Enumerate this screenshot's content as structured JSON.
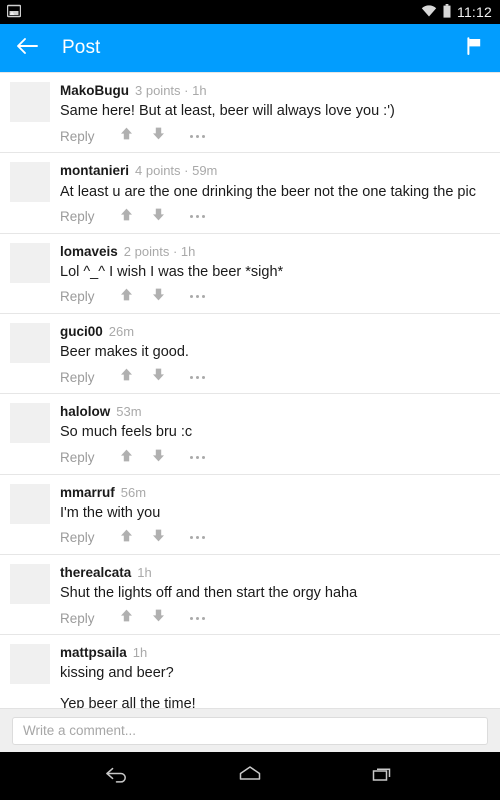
{
  "status_bar": {
    "notification_icon": "image-notification-icon",
    "wifi_icon": "wifi-icon",
    "battery_icon": "battery-icon",
    "clock": "11:12"
  },
  "app_bar": {
    "back_icon": "back-arrow-icon",
    "title": "Post",
    "flag_icon": "flag-icon",
    "background_color": "#029dfe",
    "foreground_color": "#ffffff"
  },
  "actions": {
    "reply_label": "Reply",
    "upvote_icon": "upvote-arrow-icon",
    "downvote_icon": "downvote-arrow-icon",
    "overflow_icon": "more-options-icon"
  },
  "comments": [
    {
      "author": "MakoBugu",
      "meta": "3 points · 1h",
      "paragraphs": [
        "Same here! But at least, beer will always love you :')"
      ]
    },
    {
      "author": "montanieri",
      "meta": "4 points · 59m",
      "paragraphs": [
        "At least u are the one drinking the beer not the one taking the pic"
      ]
    },
    {
      "author": "lomaveis",
      "meta": "2 points · 1h",
      "paragraphs": [
        "Lol ^_^ I wish I was the beer *sigh*"
      ]
    },
    {
      "author": "guci00",
      "meta": "26m",
      "paragraphs": [
        "Beer makes it good."
      ]
    },
    {
      "author": "halolow",
      "meta": "53m",
      "paragraphs": [
        "So much feels bru :c"
      ]
    },
    {
      "author": "mmarruf",
      "meta": "56m",
      "paragraphs": [
        "I'm the with you"
      ]
    },
    {
      "author": "therealcata",
      "meta": "1h",
      "paragraphs": [
        "Shut the lights off and then start the orgy haha"
      ]
    },
    {
      "author": "mattpsaila",
      "meta": "1h",
      "paragraphs": [
        "kissing and beer?",
        "Yep beer all the time!"
      ]
    }
  ],
  "composer": {
    "value": "",
    "placeholder": "Write a comment..."
  },
  "nav_bar": {
    "back_icon": "nav-back-icon",
    "home_icon": "nav-home-icon",
    "recents_icon": "nav-recents-icon"
  }
}
